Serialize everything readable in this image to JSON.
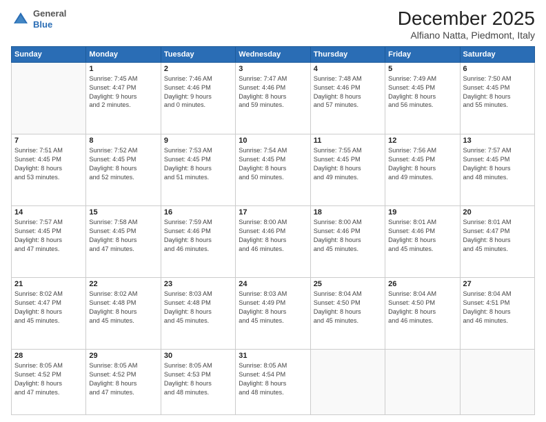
{
  "header": {
    "logo_general": "General",
    "logo_blue": "Blue",
    "month": "December 2025",
    "location": "Alfiano Natta, Piedmont, Italy"
  },
  "days_of_week": [
    "Sunday",
    "Monday",
    "Tuesday",
    "Wednesday",
    "Thursday",
    "Friday",
    "Saturday"
  ],
  "weeks": [
    [
      {
        "day": "",
        "info": ""
      },
      {
        "day": "1",
        "info": "Sunrise: 7:45 AM\nSunset: 4:47 PM\nDaylight: 9 hours\nand 2 minutes."
      },
      {
        "day": "2",
        "info": "Sunrise: 7:46 AM\nSunset: 4:46 PM\nDaylight: 9 hours\nand 0 minutes."
      },
      {
        "day": "3",
        "info": "Sunrise: 7:47 AM\nSunset: 4:46 PM\nDaylight: 8 hours\nand 59 minutes."
      },
      {
        "day": "4",
        "info": "Sunrise: 7:48 AM\nSunset: 4:46 PM\nDaylight: 8 hours\nand 57 minutes."
      },
      {
        "day": "5",
        "info": "Sunrise: 7:49 AM\nSunset: 4:45 PM\nDaylight: 8 hours\nand 56 minutes."
      },
      {
        "day": "6",
        "info": "Sunrise: 7:50 AM\nSunset: 4:45 PM\nDaylight: 8 hours\nand 55 minutes."
      }
    ],
    [
      {
        "day": "7",
        "info": "Sunrise: 7:51 AM\nSunset: 4:45 PM\nDaylight: 8 hours\nand 53 minutes."
      },
      {
        "day": "8",
        "info": "Sunrise: 7:52 AM\nSunset: 4:45 PM\nDaylight: 8 hours\nand 52 minutes."
      },
      {
        "day": "9",
        "info": "Sunrise: 7:53 AM\nSunset: 4:45 PM\nDaylight: 8 hours\nand 51 minutes."
      },
      {
        "day": "10",
        "info": "Sunrise: 7:54 AM\nSunset: 4:45 PM\nDaylight: 8 hours\nand 50 minutes."
      },
      {
        "day": "11",
        "info": "Sunrise: 7:55 AM\nSunset: 4:45 PM\nDaylight: 8 hours\nand 49 minutes."
      },
      {
        "day": "12",
        "info": "Sunrise: 7:56 AM\nSunset: 4:45 PM\nDaylight: 8 hours\nand 49 minutes."
      },
      {
        "day": "13",
        "info": "Sunrise: 7:57 AM\nSunset: 4:45 PM\nDaylight: 8 hours\nand 48 minutes."
      }
    ],
    [
      {
        "day": "14",
        "info": "Sunrise: 7:57 AM\nSunset: 4:45 PM\nDaylight: 8 hours\nand 47 minutes."
      },
      {
        "day": "15",
        "info": "Sunrise: 7:58 AM\nSunset: 4:45 PM\nDaylight: 8 hours\nand 47 minutes."
      },
      {
        "day": "16",
        "info": "Sunrise: 7:59 AM\nSunset: 4:46 PM\nDaylight: 8 hours\nand 46 minutes."
      },
      {
        "day": "17",
        "info": "Sunrise: 8:00 AM\nSunset: 4:46 PM\nDaylight: 8 hours\nand 46 minutes."
      },
      {
        "day": "18",
        "info": "Sunrise: 8:00 AM\nSunset: 4:46 PM\nDaylight: 8 hours\nand 45 minutes."
      },
      {
        "day": "19",
        "info": "Sunrise: 8:01 AM\nSunset: 4:46 PM\nDaylight: 8 hours\nand 45 minutes."
      },
      {
        "day": "20",
        "info": "Sunrise: 8:01 AM\nSunset: 4:47 PM\nDaylight: 8 hours\nand 45 minutes."
      }
    ],
    [
      {
        "day": "21",
        "info": "Sunrise: 8:02 AM\nSunset: 4:47 PM\nDaylight: 8 hours\nand 45 minutes."
      },
      {
        "day": "22",
        "info": "Sunrise: 8:02 AM\nSunset: 4:48 PM\nDaylight: 8 hours\nand 45 minutes."
      },
      {
        "day": "23",
        "info": "Sunrise: 8:03 AM\nSunset: 4:48 PM\nDaylight: 8 hours\nand 45 minutes."
      },
      {
        "day": "24",
        "info": "Sunrise: 8:03 AM\nSunset: 4:49 PM\nDaylight: 8 hours\nand 45 minutes."
      },
      {
        "day": "25",
        "info": "Sunrise: 8:04 AM\nSunset: 4:50 PM\nDaylight: 8 hours\nand 45 minutes."
      },
      {
        "day": "26",
        "info": "Sunrise: 8:04 AM\nSunset: 4:50 PM\nDaylight: 8 hours\nand 46 minutes."
      },
      {
        "day": "27",
        "info": "Sunrise: 8:04 AM\nSunset: 4:51 PM\nDaylight: 8 hours\nand 46 minutes."
      }
    ],
    [
      {
        "day": "28",
        "info": "Sunrise: 8:05 AM\nSunset: 4:52 PM\nDaylight: 8 hours\nand 47 minutes."
      },
      {
        "day": "29",
        "info": "Sunrise: 8:05 AM\nSunset: 4:52 PM\nDaylight: 8 hours\nand 47 minutes."
      },
      {
        "day": "30",
        "info": "Sunrise: 8:05 AM\nSunset: 4:53 PM\nDaylight: 8 hours\nand 48 minutes."
      },
      {
        "day": "31",
        "info": "Sunrise: 8:05 AM\nSunset: 4:54 PM\nDaylight: 8 hours\nand 48 minutes."
      },
      {
        "day": "",
        "info": ""
      },
      {
        "day": "",
        "info": ""
      },
      {
        "day": "",
        "info": ""
      }
    ]
  ]
}
